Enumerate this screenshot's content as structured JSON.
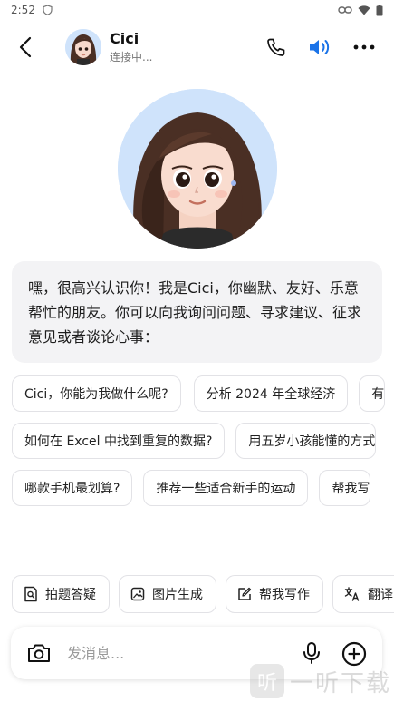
{
  "status_bar": {
    "time": "2:52"
  },
  "header": {
    "name": "Cici",
    "subtitle": "连接中..."
  },
  "greeting": "嘿，很高兴认识你！我是Cici，你幽默、友好、乐意帮忙的朋友。你可以向我询问问题、寻求建议、征求意见或者谈论心事：",
  "suggestions": [
    [
      "Cici，你能为我做什么呢?",
      "分析 2024 年全球经济",
      "有"
    ],
    [
      "如何在 Excel 中找到重复的数据?",
      "用五岁小孩能懂的方式"
    ],
    [
      "哪款手机最划算?",
      "推荐一些适合新手的运动",
      "帮我写"
    ]
  ],
  "tools": [
    "拍题答疑",
    "图片生成",
    "帮我写作",
    "翻译"
  ],
  "input": {
    "placeholder": "发消息..."
  },
  "watermark": {
    "text": "一听下载",
    "logo": "听"
  },
  "colors": {
    "accent": "#1a73e8",
    "bubble": "#f3f3f5"
  }
}
